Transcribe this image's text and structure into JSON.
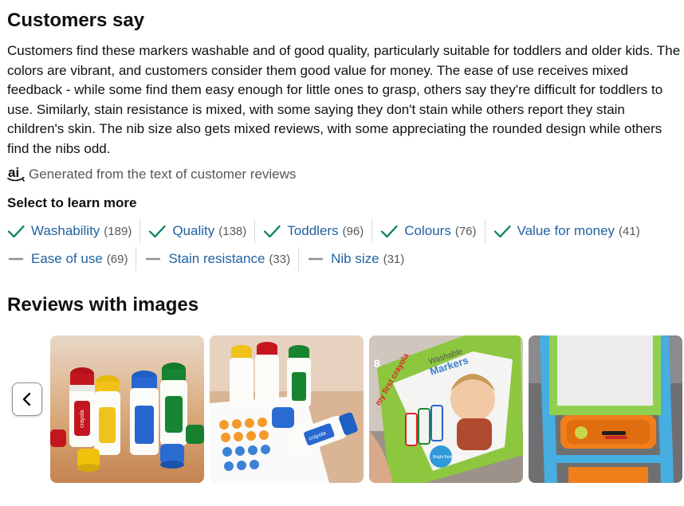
{
  "customers_say": {
    "title": "Customers say",
    "summary": "Customers find these markers washable and of good quality, particularly suitable for toddlers and older kids. The colors are vibrant, and customers consider them good value for money. The ease of use receives mixed feedback - while some find them easy enough for little ones to grasp, others say they're difficult for toddlers to use. Similarly, stain resistance is mixed, with some saying they don't stain while others report they stain children's skin. The nib size also gets mixed reviews, with some appreciating the rounded design while others find the nibs odd.",
    "ai_icon_text": "ai",
    "ai_note": "Generated from the text of customer reviews"
  },
  "select_more": {
    "title": "Select to learn more",
    "positive_icon": "check-icon",
    "mixed_icon": "dash-icon",
    "colors": {
      "check": "#067d62",
      "dash": "#8d9096",
      "link": "#2162a1"
    },
    "row1": [
      {
        "label": "Washability",
        "count": "(189)"
      },
      {
        "label": "Quality",
        "count": "(138)"
      },
      {
        "label": "Toddlers",
        "count": "(96)"
      },
      {
        "label": "Colours",
        "count": "(76)"
      },
      {
        "label": "Value for money",
        "count": "(41)"
      }
    ],
    "row2": [
      {
        "label": "Ease of use",
        "count": "(69)"
      },
      {
        "label": "Stain resistance",
        "count": "(33)"
      },
      {
        "label": "Nib size",
        "count": "(31)"
      }
    ]
  },
  "reviews_with_images": {
    "title": "Reviews with images",
    "prev_icon": "chevron-left-icon",
    "images": [
      {
        "brand_text": "crayola"
      },
      {
        "brand_text": "crayola"
      },
      {
        "brand_text": "my first crayola",
        "box_text_1": "Washable",
        "box_text_2": "Markers",
        "count": "8",
        "badge": "Bright Bold Colours"
      },
      {
        "brand_text": ""
      }
    ]
  }
}
